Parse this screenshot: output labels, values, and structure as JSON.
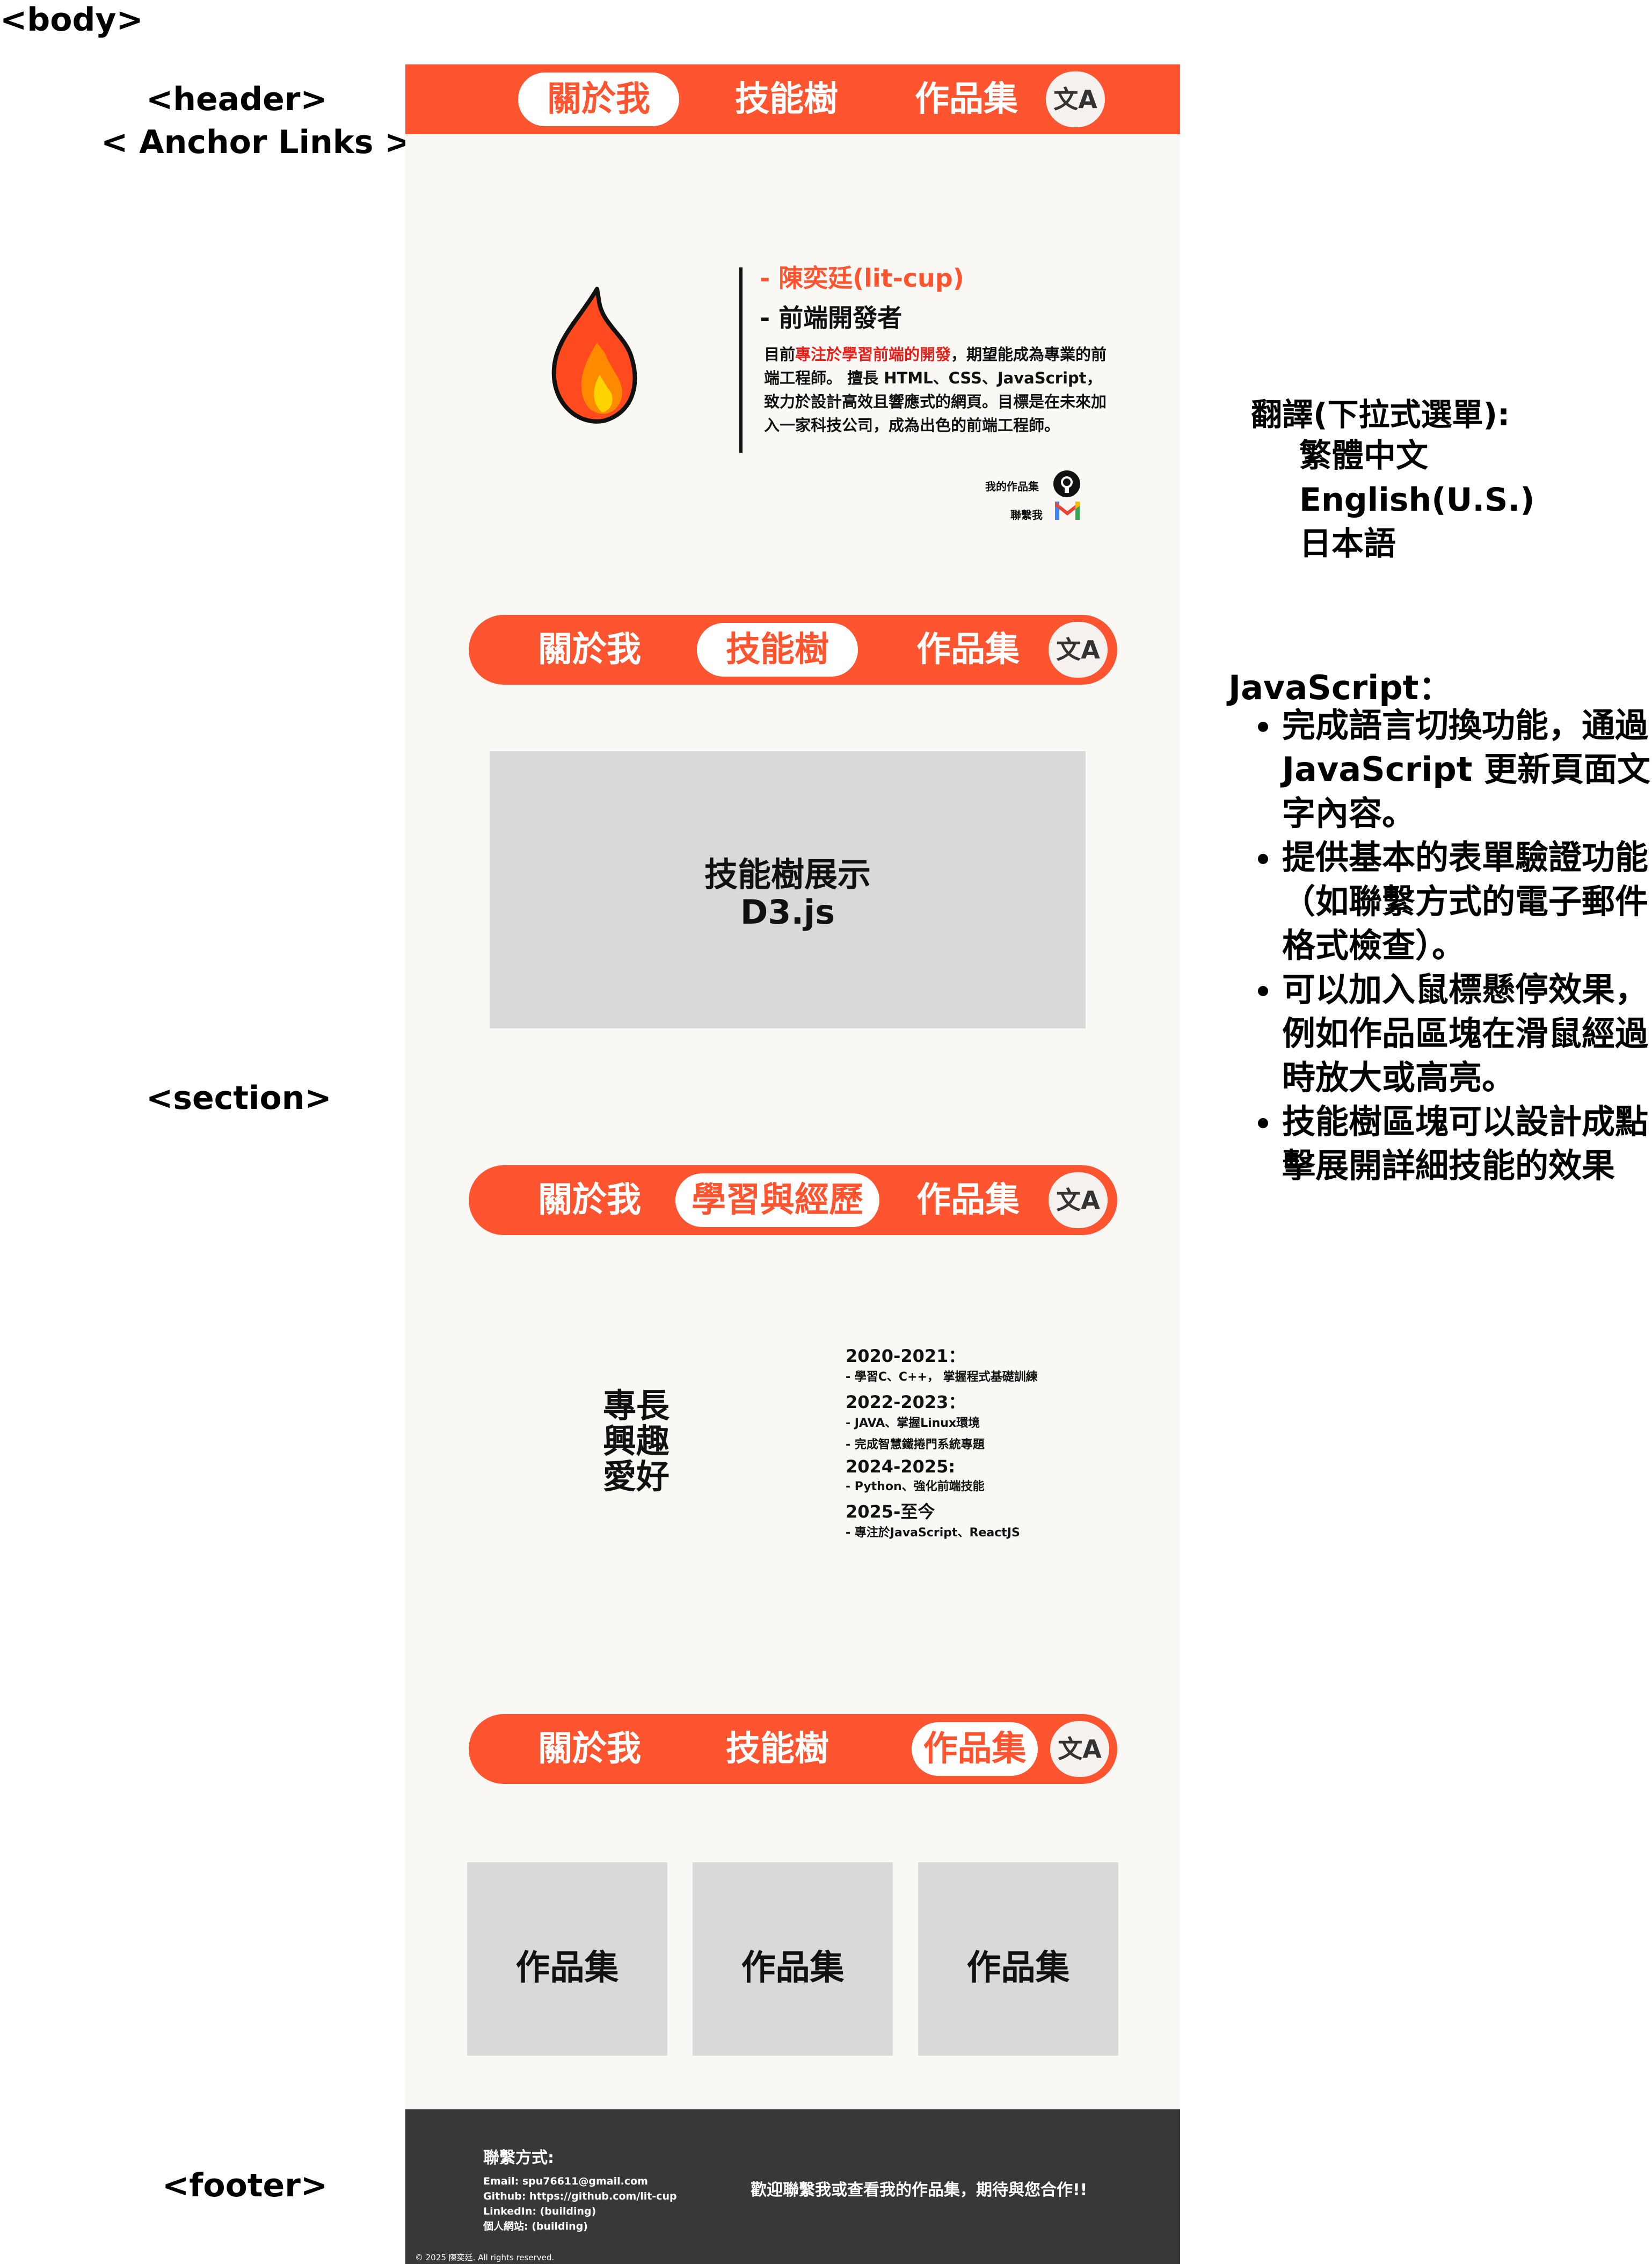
{
  "annotations": {
    "body": "<body>",
    "header": "<header>",
    "anchor_links": "< Anchor Links >",
    "section": "<section>",
    "footer": "<footer>",
    "translation_title": "翻譯(下拉式選單):",
    "languages": [
      "繁體中文",
      "English(U.S.)",
      "日本語"
    ],
    "js_title": "JavaScript：",
    "js_points": [
      "完成語言切換功能，通過 JavaScript 更新頁面文字內容。",
      "提供基本的表單驗證功能（如聯繫方式的電子郵件格式檢查）。",
      "可以加入鼠標懸停效果，例如作品區塊在滑鼠經過時放大或高亮。",
      "技能樹區塊可以設計成點擊展開詳細技能的效果"
    ]
  },
  "nav": {
    "about": "關於我",
    "skills": "技能樹",
    "works": "作品集",
    "experience": "學習與經歷",
    "lang_icon": "translate-icon",
    "lang_glyph": "文A"
  },
  "hero": {
    "name": "- 陳奕廷(lit-cup)",
    "role": "- 前端開發者",
    "bio_prefix": "目前",
    "bio_highlight": "專注於學習前端的開發",
    "bio_rest": "，期望能成為專業的前端工程師。 擅長 HTML、CSS、JavaScript，致力於設計高效且響應式的網頁。目標是在未來加入一家科技公司，成為出色的前端工程師。",
    "portfolio_link": "我的作品集",
    "contact_link": "聯繫我",
    "logo_icon": "flame-icon",
    "github_icon": "github-icon",
    "gmail_icon": "gmail-icon"
  },
  "skills": {
    "placeholder_line1": "技能樹展示",
    "placeholder_line2": "D3.js"
  },
  "experience": {
    "label_lines": [
      "專長",
      "興趣",
      "愛好"
    ],
    "timeline": [
      {
        "year": "2020-2021：",
        "items": [
          "- 學習C、C++，  掌握程式基礎訓練"
        ]
      },
      {
        "year": "2022-2023：",
        "items": [
          "-  JAVA、掌握Linux環境",
          "- 完成智慧鐵捲門系統專題"
        ]
      },
      {
        "year": "2024-2025:",
        "items": [
          "- Python、強化前端技能"
        ]
      },
      {
        "year": "2025-至今",
        "items": [
          "- 專注於JavaScript、ReactJS"
        ]
      }
    ]
  },
  "works": {
    "cards": [
      "作品集",
      "作品集",
      "作品集"
    ]
  },
  "footer": {
    "contact_title": "聯繫方式:",
    "email": "Email:   spu76611@gmail.com",
    "github": "Github:  https://github.com/lit-cup",
    "linkedin": "LinkedIn: (building)",
    "website": "個人網站: (building)",
    "message": "歡迎聯繫我或查看我的作品集，期待與您合作!!",
    "copyright": "© 2025 陳奕廷. All rights reserved."
  },
  "colors": {
    "accent": "#fe5530",
    "page_bg": "#f9f8f5",
    "placeholder": "#d9d9d9",
    "footer_bg": "#383838",
    "highlight": "#e8201a"
  }
}
